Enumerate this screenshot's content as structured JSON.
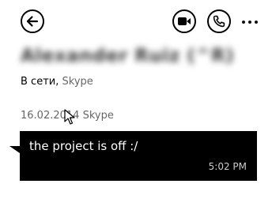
{
  "header": {
    "icons": {
      "back": "back-arrow-icon",
      "video": "video-camera-icon",
      "call": "phone-icon",
      "more": "more-dots-icon"
    }
  },
  "contact": {
    "name": "Alexander Ruiz (^R)",
    "status": "В сети,",
    "service": "Skype"
  },
  "conversation": {
    "date_header": "16.02.2014 Skype",
    "messages": [
      {
        "text": "the project is off :/",
        "time": "5:02 PM"
      }
    ]
  },
  "colors": {
    "background": "#ffffff",
    "bubble": "#000000",
    "bubble_text": "#ffffff",
    "secondary_text": "#666666"
  }
}
